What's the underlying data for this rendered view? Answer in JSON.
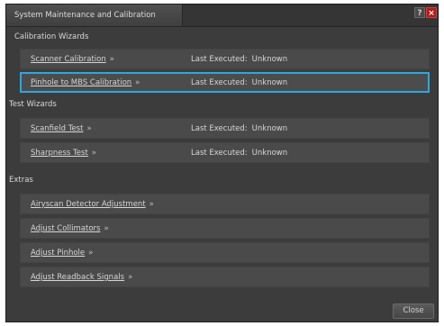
{
  "window": {
    "title": "System Maintenance and Calibration",
    "help_label": "?",
    "close_label": "×"
  },
  "sections": {
    "calibration": "Calibration Wizards",
    "test": "Test Wizards",
    "extras": "Extras"
  },
  "status_label": "Last Executed:",
  "arrow": "»",
  "rows": {
    "scanner": {
      "label": "Scanner Calibration",
      "status": "Unknown"
    },
    "pinhole_mbs": {
      "label": "Pinhole to MBS Calibration",
      "status": "Unknown"
    },
    "scanfield": {
      "label": "Scanfield Test",
      "status": "Unknown"
    },
    "sharpness": {
      "label": "Sharpness Test",
      "status": "Unknown"
    },
    "airyscan": {
      "label": "Airyscan Detector Adjustment"
    },
    "collimators": {
      "label": "Adjust Collimators"
    },
    "pinhole": {
      "label": "Adjust Pinhole"
    },
    "readback": {
      "label": "Adjust Readback Signals"
    }
  },
  "footer": {
    "close_label": "Close"
  },
  "colors": {
    "selection_border": "#29a9e1",
    "close_button": "#b01c1c"
  }
}
